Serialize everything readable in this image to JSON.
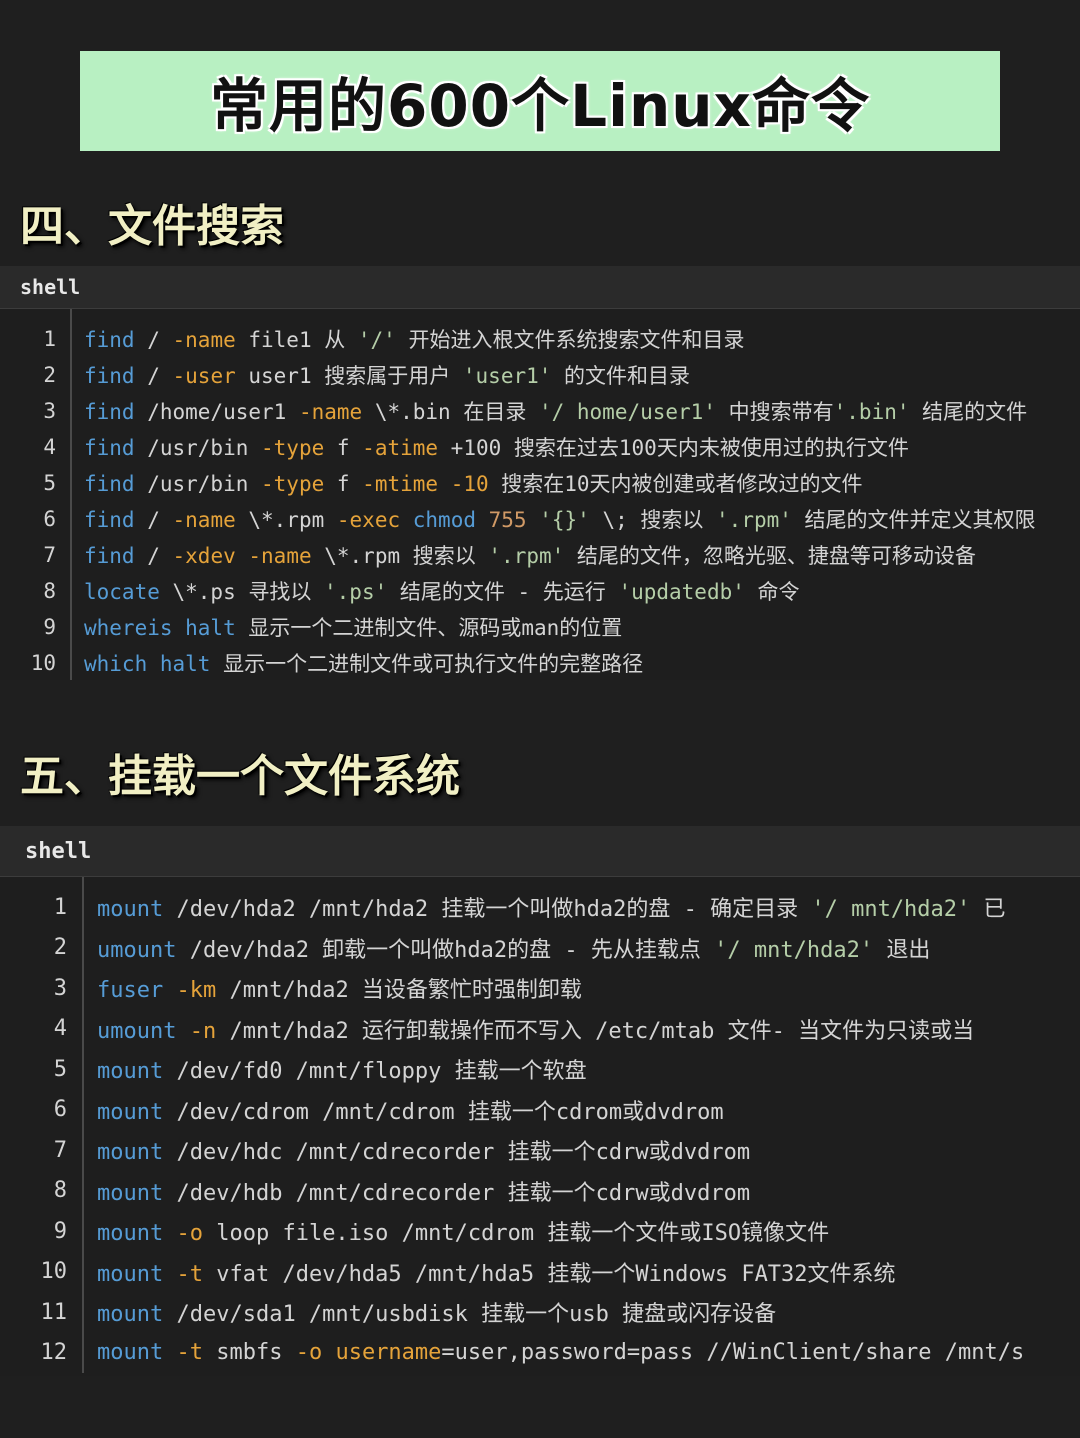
{
  "banner": {
    "title": "常用的600个Linux命令"
  },
  "sections": [
    {
      "heading": "四、文件搜索",
      "code_block": {
        "lang_label": "shell",
        "lines": [
          {
            "n": "1",
            "tokens": [
              {
                "t": "find",
                "k": "cmd"
              },
              {
                "t": " / ",
                "k": "txt"
              },
              {
                "t": "-name",
                "k": "flag"
              },
              {
                "t": " file1 从 ",
                "k": "txt"
              },
              {
                "t": "'/'",
                "k": "str"
              },
              {
                "t": " 开始进入根文件系统搜索文件和目录",
                "k": "txt"
              }
            ]
          },
          {
            "n": "2",
            "tokens": [
              {
                "t": "find",
                "k": "cmd"
              },
              {
                "t": " / ",
                "k": "txt"
              },
              {
                "t": "-user",
                "k": "flag"
              },
              {
                "t": " user1 搜索属于用户 ",
                "k": "txt"
              },
              {
                "t": "'user1'",
                "k": "str"
              },
              {
                "t": " 的文件和目录",
                "k": "txt"
              }
            ]
          },
          {
            "n": "3",
            "tokens": [
              {
                "t": "find",
                "k": "cmd"
              },
              {
                "t": " /home/user1 ",
                "k": "txt"
              },
              {
                "t": "-name",
                "k": "flag"
              },
              {
                "t": " \\*.bin 在目录 ",
                "k": "txt"
              },
              {
                "t": "'/ home/user1'",
                "k": "str"
              },
              {
                "t": " 中搜索带有",
                "k": "txt"
              },
              {
                "t": "'.bin'",
                "k": "str"
              },
              {
                "t": " 结尾的文件",
                "k": "txt"
              }
            ]
          },
          {
            "n": "4",
            "tokens": [
              {
                "t": "find",
                "k": "cmd"
              },
              {
                "t": " /usr/bin ",
                "k": "txt"
              },
              {
                "t": "-type",
                "k": "flag"
              },
              {
                "t": " f ",
                "k": "txt"
              },
              {
                "t": "-atime",
                "k": "flag"
              },
              {
                "t": " +100 搜索在过去100天内未被使用过的执行文件",
                "k": "txt"
              }
            ]
          },
          {
            "n": "5",
            "tokens": [
              {
                "t": "find",
                "k": "cmd"
              },
              {
                "t": " /usr/bin ",
                "k": "txt"
              },
              {
                "t": "-type",
                "k": "flag"
              },
              {
                "t": " f ",
                "k": "txt"
              },
              {
                "t": "-mtime",
                "k": "flag"
              },
              {
                "t": " ",
                "k": "txt"
              },
              {
                "t": "-10",
                "k": "flag"
              },
              {
                "t": " 搜索在10天内被创建或者修改过的文件",
                "k": "txt"
              }
            ]
          },
          {
            "n": "6",
            "tokens": [
              {
                "t": "find",
                "k": "cmd"
              },
              {
                "t": " / ",
                "k": "txt"
              },
              {
                "t": "-name",
                "k": "flag"
              },
              {
                "t": " \\*.rpm ",
                "k": "txt"
              },
              {
                "t": "-exec",
                "k": "flag"
              },
              {
                "t": " ",
                "k": "txt"
              },
              {
                "t": "chmod",
                "k": "cmd"
              },
              {
                "t": " ",
                "k": "txt"
              },
              {
                "t": "755",
                "k": "num"
              },
              {
                "t": " ",
                "k": "txt"
              },
              {
                "t": "'{}'",
                "k": "str"
              },
              {
                "t": " \\; 搜索以 ",
                "k": "txt"
              },
              {
                "t": "'.rpm'",
                "k": "str"
              },
              {
                "t": " 结尾的文件并定义其权限",
                "k": "txt"
              }
            ]
          },
          {
            "n": "7",
            "tokens": [
              {
                "t": "find",
                "k": "cmd"
              },
              {
                "t": " / ",
                "k": "txt"
              },
              {
                "t": "-xdev",
                "k": "flag"
              },
              {
                "t": " ",
                "k": "txt"
              },
              {
                "t": "-name",
                "k": "flag"
              },
              {
                "t": " \\*.rpm 搜索以 ",
                "k": "txt"
              },
              {
                "t": "'.rpm'",
                "k": "str"
              },
              {
                "t": " 结尾的文件，忽略光驱、捷盘等可移动设备",
                "k": "txt"
              }
            ]
          },
          {
            "n": "8",
            "tokens": [
              {
                "t": "locate",
                "k": "cmd"
              },
              {
                "t": " \\*.ps 寻找以 ",
                "k": "txt"
              },
              {
                "t": "'.ps'",
                "k": "str"
              },
              {
                "t": " 结尾的文件 - 先运行 ",
                "k": "txt"
              },
              {
                "t": "'updatedb'",
                "k": "str"
              },
              {
                "t": " 命令",
                "k": "txt"
              }
            ]
          },
          {
            "n": "9",
            "tokens": [
              {
                "t": "whereis halt",
                "k": "cmd"
              },
              {
                "t": " 显示一个二进制文件、源码或man的位置",
                "k": "txt"
              }
            ]
          },
          {
            "n": "10",
            "tokens": [
              {
                "t": "which halt",
                "k": "cmd"
              },
              {
                "t": " 显示一个二进制文件或可执行文件的完整路径",
                "k": "txt"
              }
            ]
          }
        ]
      }
    },
    {
      "heading": "五、挂载一个文件系统",
      "code_block": {
        "lang_label": "shell",
        "lines": [
          {
            "n": "1",
            "tokens": [
              {
                "t": "mount",
                "k": "cmd"
              },
              {
                "t": " /dev/hda2 /mnt/hda2 挂载一个叫做hda2的盘 - 确定目录 ",
                "k": "txt"
              },
              {
                "t": "'/ mnt/hda2'",
                "k": "str"
              },
              {
                "t": " 已",
                "k": "txt"
              }
            ]
          },
          {
            "n": "2",
            "tokens": [
              {
                "t": "umount",
                "k": "cmd"
              },
              {
                "t": " /dev/hda2 卸载一个叫做hda2的盘 - 先从挂载点 ",
                "k": "txt"
              },
              {
                "t": "'/ mnt/hda2'",
                "k": "str"
              },
              {
                "t": " 退出",
                "k": "txt"
              }
            ]
          },
          {
            "n": "3",
            "tokens": [
              {
                "t": "fuser",
                "k": "cmd"
              },
              {
                "t": " ",
                "k": "txt"
              },
              {
                "t": "-km",
                "k": "flag"
              },
              {
                "t": " /mnt/hda2 当设备繁忙时强制卸载",
                "k": "txt"
              }
            ]
          },
          {
            "n": "4",
            "tokens": [
              {
                "t": "umount",
                "k": "cmd"
              },
              {
                "t": " ",
                "k": "txt"
              },
              {
                "t": "-n",
                "k": "flag"
              },
              {
                "t": " /mnt/hda2 运行卸载操作而不写入 /etc/mtab 文件- 当文件为只读或当",
                "k": "txt"
              }
            ]
          },
          {
            "n": "5",
            "tokens": [
              {
                "t": "mount",
                "k": "cmd"
              },
              {
                "t": " /dev/fd0 /mnt/floppy 挂载一个软盘",
                "k": "txt"
              }
            ]
          },
          {
            "n": "6",
            "tokens": [
              {
                "t": "mount",
                "k": "cmd"
              },
              {
                "t": " /dev/cdrom /mnt/cdrom 挂载一个cdrom或dvdrom",
                "k": "txt"
              }
            ]
          },
          {
            "n": "7",
            "tokens": [
              {
                "t": "mount",
                "k": "cmd"
              },
              {
                "t": " /dev/hdc /mnt/cdrecorder 挂载一个cdrw或dvdrom",
                "k": "txt"
              }
            ]
          },
          {
            "n": "8",
            "tokens": [
              {
                "t": "mount",
                "k": "cmd"
              },
              {
                "t": " /dev/hdb /mnt/cdrecorder 挂载一个cdrw或dvdrom",
                "k": "txt"
              }
            ]
          },
          {
            "n": "9",
            "tokens": [
              {
                "t": "mount",
                "k": "cmd"
              },
              {
                "t": " ",
                "k": "txt"
              },
              {
                "t": "-o",
                "k": "flag"
              },
              {
                "t": " loop file.iso /mnt/cdrom 挂载一个文件或ISO镜像文件",
                "k": "txt"
              }
            ]
          },
          {
            "n": "10",
            "tokens": [
              {
                "t": "mount",
                "k": "cmd"
              },
              {
                "t": " ",
                "k": "txt"
              },
              {
                "t": "-t",
                "k": "flag"
              },
              {
                "t": " vfat /dev/hda5 /mnt/hda5 挂载一个Windows FAT32文件系统",
                "k": "txt"
              }
            ]
          },
          {
            "n": "11",
            "tokens": [
              {
                "t": "mount",
                "k": "cmd"
              },
              {
                "t": " /dev/sda1 /mnt/usbdisk 挂载一个usb 捷盘或闪存设备",
                "k": "txt"
              }
            ]
          },
          {
            "n": "12",
            "tokens": [
              {
                "t": "mount",
                "k": "cmd"
              },
              {
                "t": " ",
                "k": "txt"
              },
              {
                "t": "-t",
                "k": "flag"
              },
              {
                "t": " smbfs ",
                "k": "txt"
              },
              {
                "t": "-o",
                "k": "flag"
              },
              {
                "t": " ",
                "k": "txt"
              },
              {
                "t": "username",
                "k": "flag"
              },
              {
                "t": "=user,password=pass //WinClient/share /mnt/s",
                "k": "txt"
              }
            ]
          }
        ]
      }
    }
  ],
  "colors": {
    "banner_bg": "#b8f0c2",
    "page_bg": "#1f1f1f",
    "heading": "#f1efc4",
    "cmd": "#569cd6",
    "flag": "#e5a33a",
    "string": "#b5cea8",
    "number": "#d19a66",
    "text": "#d4d4d4"
  }
}
